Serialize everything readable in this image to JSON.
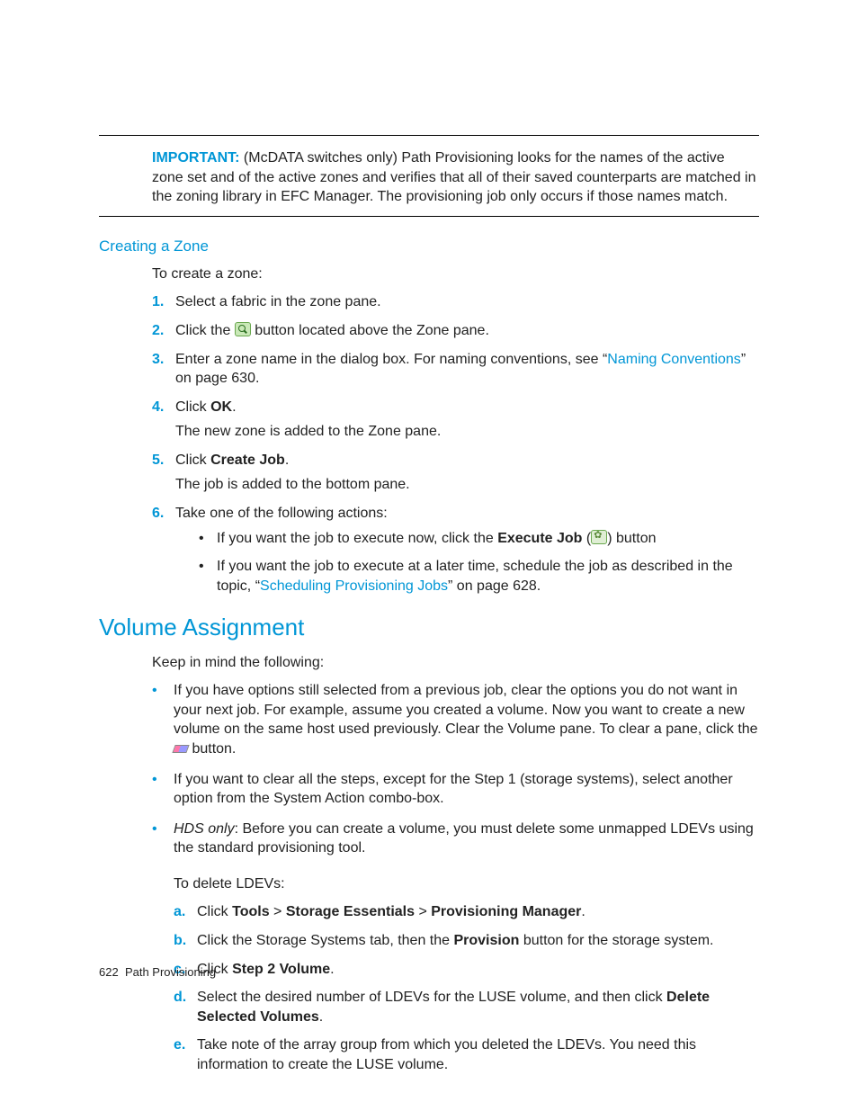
{
  "important": {
    "label": "IMPORTANT:",
    "text": "(McDATA switches only) Path Provisioning looks for the names of the active zone set and of the active zones and verifies that all of their saved counterparts are matched in the zoning library in EFC Manager. The provisioning job only occurs if those names match."
  },
  "creating_zone": {
    "heading": "Creating a Zone",
    "intro": "To create a zone:",
    "steps": {
      "s1": "Select a fabric in the zone pane.",
      "s2a": "Click the ",
      "s2b": " button located above the Zone pane.",
      "s3a": "Enter a zone name in the dialog box. For naming conventions, see “",
      "s3link": "Naming Conventions",
      "s3b": "” on page 630.",
      "s4a": "Click ",
      "s4bold": "OK",
      "s4b": ".",
      "s4cont": "The new zone is added to the Zone pane.",
      "s5a": "Click ",
      "s5bold": "Create Job",
      "s5b": ".",
      "s5cont": "The job is added to the bottom pane.",
      "s6": "Take one of the following actions:",
      "s6b1a": "If you want the job to execute now, click the ",
      "s6b1bold": "Execute Job",
      "s6b1b": " (",
      "s6b1c": ") button",
      "s6b2a": "If you want the job to execute at a later time, schedule the job as described in the topic, “",
      "s6b2link": "Scheduling Provisioning Jobs",
      "s6b2b": "” on page 628."
    }
  },
  "volume_assignment": {
    "heading": "Volume Assignment",
    "intro": "Keep in mind the following:",
    "bullets": {
      "b1a": "If you have options still selected from a previous job, clear the options you do not want in your next job. For example, assume you created a volume. Now you want to create a new volume on the same host used previously. Clear the Volume pane. To clear a pane, click the ",
      "b1b": " button.",
      "b2": "If you want to clear all the steps, except for the Step 1 (storage systems), select another option from the System Action combo-box.",
      "b3ital": "HDS only",
      "b3a": ": Before you can create a volume, you must delete some unmapped LDEVs using the standard provisioning tool.",
      "sub_intro": "To delete LDEVs:",
      "la_a": "Click ",
      "la_b1": "Tools",
      "la_gt": " > ",
      "la_b2": "Storage Essentials",
      "la_b3": "Provisioning Manager",
      "la_end": ".",
      "lb_a": "Click the Storage Systems tab, then the ",
      "lb_bold": "Provision",
      "lb_b": " button for the storage system.",
      "lc_a": "Click ",
      "lc_bold": "Step 2 Volume",
      "lc_b": ".",
      "ld_a": "Select the desired number of LDEVs for the LUSE volume, and then click ",
      "ld_bold": "Delete Selected Volumes",
      "ld_b": ".",
      "le": "Take note of the array group from which you deleted the LDEVs. You need this information to create the LUSE volume."
    }
  },
  "footer": {
    "page": "622",
    "title": "Path Provisioning"
  }
}
